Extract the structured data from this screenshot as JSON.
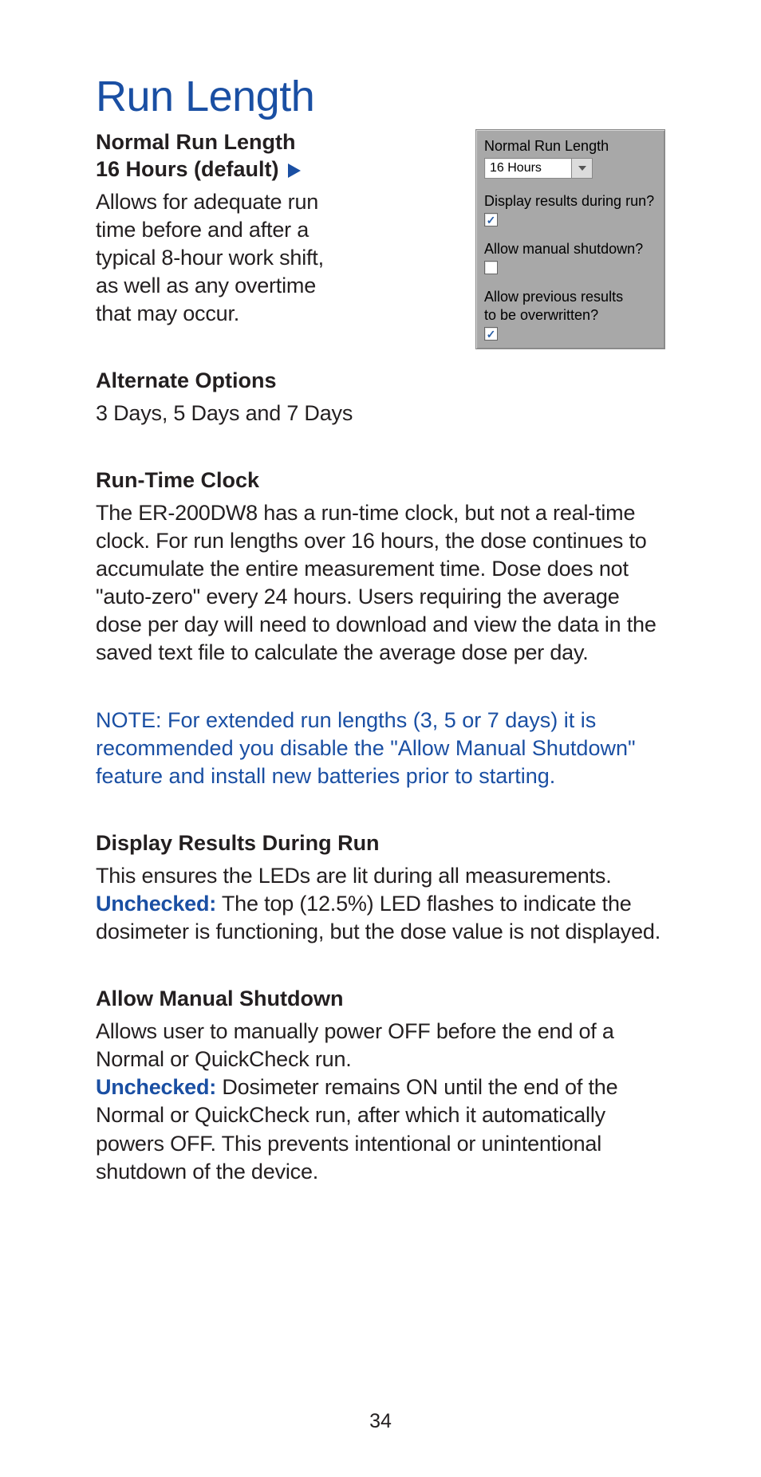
{
  "page_title": "Run Length",
  "page_number": "34",
  "figure": {
    "label_run_length": "Normal Run Length",
    "dropdown_value": "16 Hours",
    "label_display_results": "Display results during run?",
    "display_results_checked": true,
    "label_allow_manual": "Allow manual shutdown?",
    "allow_manual_checked": false,
    "label_overwritten_1": "Allow previous results",
    "label_overwritten_2": "to be overwritten?",
    "overwritten_checked": true
  },
  "sections": {
    "normal": {
      "heading_line1": "Normal Run Length",
      "heading_line2": "16 Hours (default)",
      "body": "Allows for adequate run time before and after a typical 8-hour work shift, as well as any overtime that may occur."
    },
    "alternate": {
      "heading": "Alternate Options",
      "body": "3 Days, 5 Days and 7 Days"
    },
    "runtime": {
      "heading": "Run-Time Clock",
      "body": "The ER-200DW8 has a run-time clock, but not a real-time clock. For run lengths over 16 hours, the dose continues to accumulate the entire measurement time. Dose does not \"auto-zero\" every 24 hours. Users requiring the average dose per day will need to download and view the data in the saved text file to calculate the average dose per day."
    },
    "note": "NOTE: For extended run lengths (3, 5 or 7 days) it is recommended you disable the \"Allow Manual Shutdown\" feature and install new batteries prior to starting.",
    "display_results": {
      "heading": "Display Results During Run",
      "body_pre": "This ensures the LEDs are lit during all measurements. ",
      "unchecked_label": "Unchecked:",
      "body_post": " The top (12.5%) LED flashes to indicate the dosimeter is functioning, but the dose value is not displayed."
    },
    "allow_manual": {
      "heading": "Allow Manual Shutdown",
      "body_pre": "Allows user to manually power OFF before the end of a Normal or QuickCheck run.",
      "unchecked_label": "Unchecked:",
      "body_post": " Dosimeter remains ON until the end of the Normal or QuickCheck run, after which it automatically powers OFF. This prevents intentional or unintentional shutdown of the device."
    }
  }
}
